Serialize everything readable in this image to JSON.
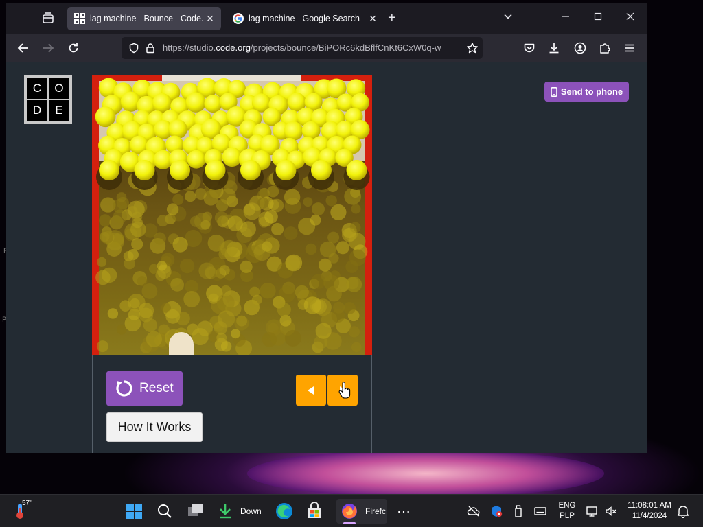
{
  "browser": {
    "tabs": [
      {
        "title": "lag machine - Bounce - Code.org",
        "active": true
      },
      {
        "title": "lag machine - Google Search",
        "active": false
      }
    ],
    "url": {
      "prefix": "https://studio.",
      "domain": "code.org",
      "path": "/projects/bounce/BiPORc6kdBflfCnKt6CxW0q-w"
    }
  },
  "page": {
    "logo_letters": [
      "C",
      "O",
      "D",
      "E"
    ],
    "send_to_phone_label": "Send to phone",
    "reset_label": "Reset",
    "how_it_works_label": "How It Works"
  },
  "desktop": {
    "edge_letters": [
      "E",
      "P"
    ]
  },
  "taskbar": {
    "weather_temp": "57°",
    "download_label": "Down",
    "firefox_label": "Firefc",
    "lang_top": "ENG",
    "lang_bottom": "PLP",
    "time": "11:08:01 AM",
    "date": "11/4/2024"
  },
  "colors": {
    "accent_purple": "#8c52ba",
    "arrow_orange": "#ffa400",
    "ball_yellow": "#f2f20a",
    "wall_red": "#d4200e",
    "page_bg": "#232b33"
  }
}
